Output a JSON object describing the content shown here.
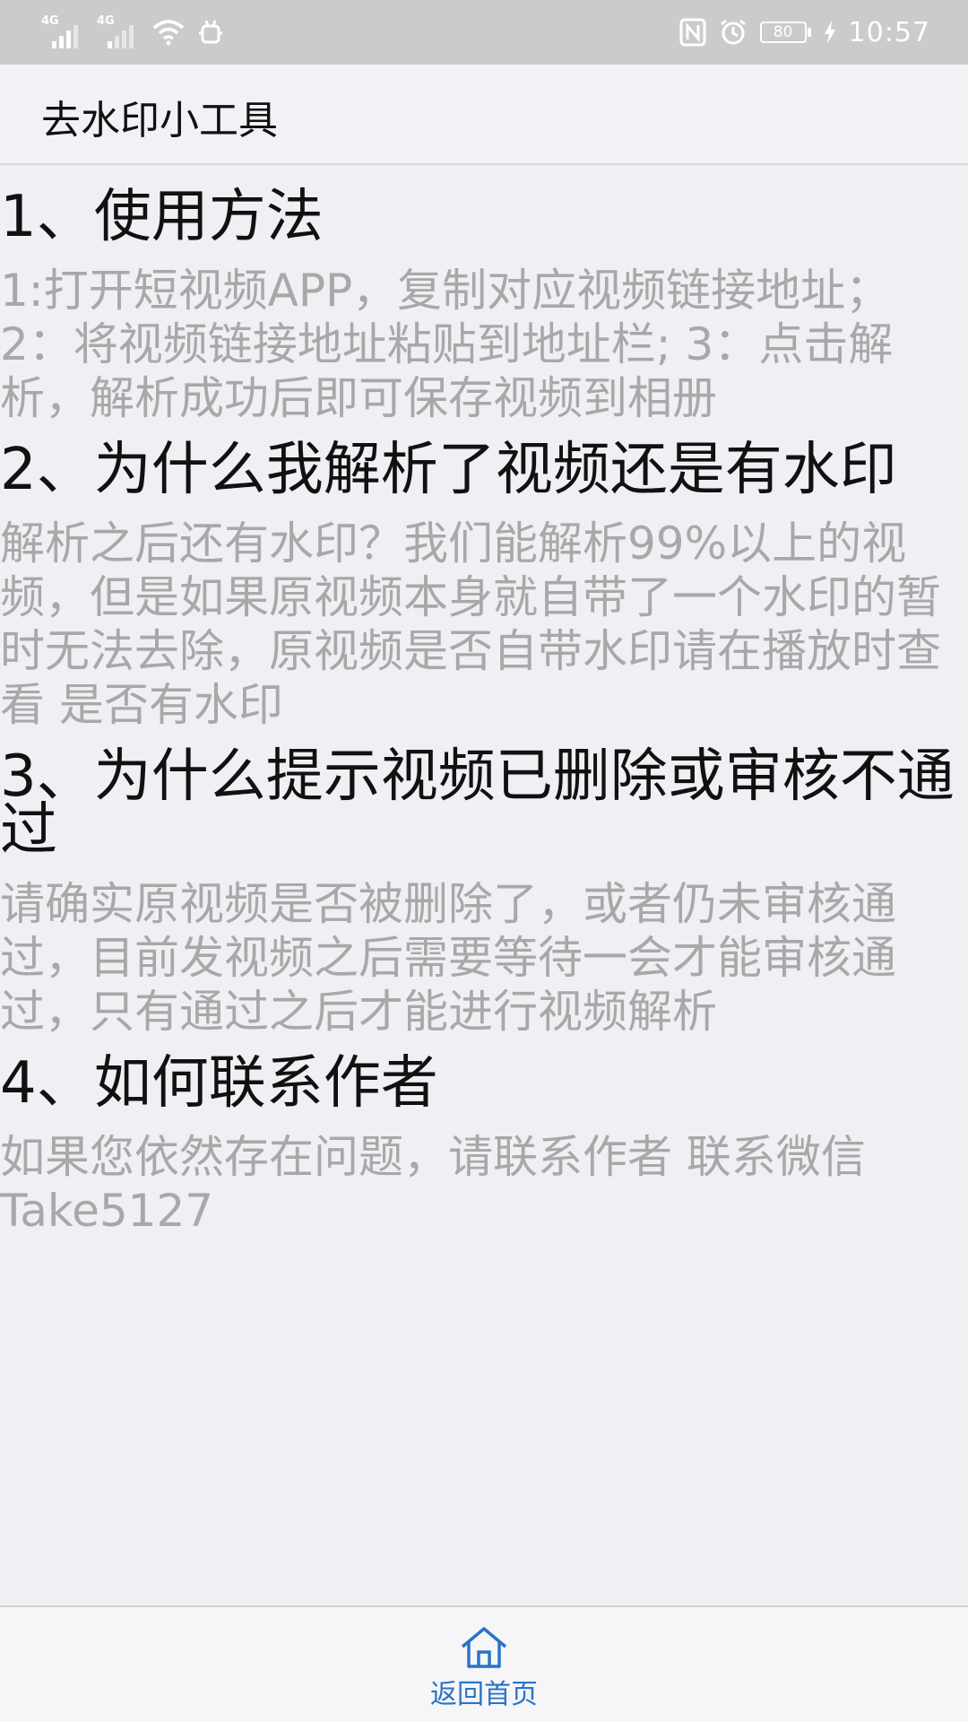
{
  "status_bar": {
    "network_1": "4G",
    "network_2": "4G",
    "battery": "80",
    "time": "10:57"
  },
  "app": {
    "title": "去水印小工具"
  },
  "sections": [
    {
      "heading": "1、使用方法",
      "body": "1:打开短视频APP，复制对应视频链接地址； 2：将视频链接地址粘贴到地址栏; 3：点击解析，解析成功后即可保存视频到相册"
    },
    {
      "heading": "2、为什么我解析了视频还是有水印",
      "body": "解析之后还有水印？我们能解析99%以上的视频，但是如果原视频本身就自带了一个水印的暂时无法去除，原视频是否自带水印请在播放时查看 是否有水印"
    },
    {
      "heading": "3、为什么提示视频已删除或审核不通过",
      "body": "请确实原视频是否被删除了，或者仍未审核通过，目前发视频之后需要等待一会才能审核通过，只有通过之后才能进行视频解析"
    },
    {
      "heading": "4、如何联系作者",
      "body": "如果您依然存在问题，请联系作者 联系微信 Take5127"
    }
  ],
  "bottom_nav": {
    "home_label": "返回首页",
    "home_icon": "home-icon",
    "accent": "#2a73c8"
  }
}
